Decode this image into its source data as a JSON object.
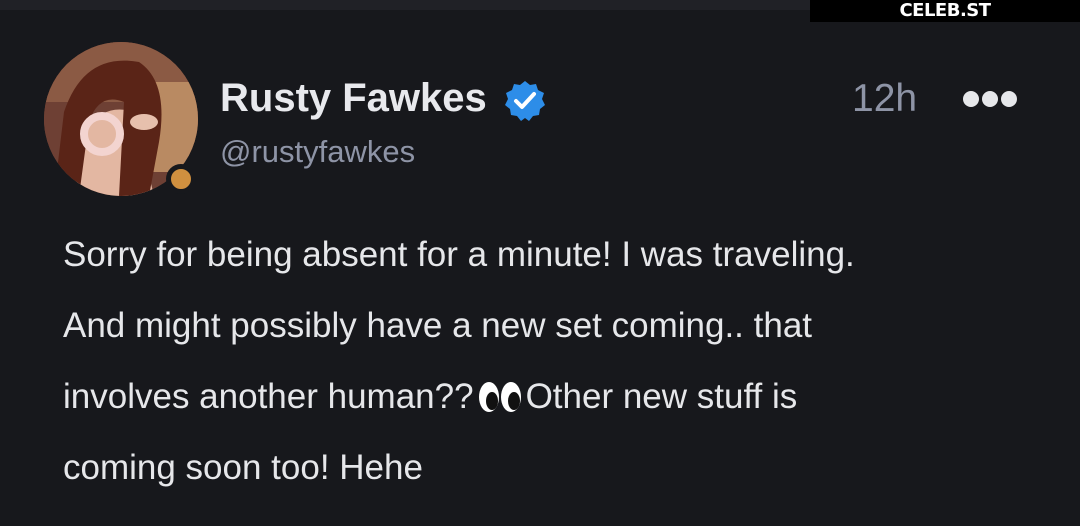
{
  "watermark": "CELEB.ST",
  "post": {
    "author": {
      "display_name": "Rusty Fawkes",
      "handle": "@rustyfawkes",
      "verified": true,
      "status_color": "#d0903f"
    },
    "timestamp": "12h",
    "lines": [
      "Sorry for being absent for a minute! I was traveling.",
      "And might possibly have a new set coming.. that",
      "involves another human??",
      "Other new stuff is",
      "coming soon too! Hehe"
    ],
    "emoji": "eyes-icon"
  },
  "colors": {
    "background": "#17181c",
    "text": "#e6e7ea",
    "muted": "#8e94a6",
    "verified_badge": "#2d8de8"
  }
}
